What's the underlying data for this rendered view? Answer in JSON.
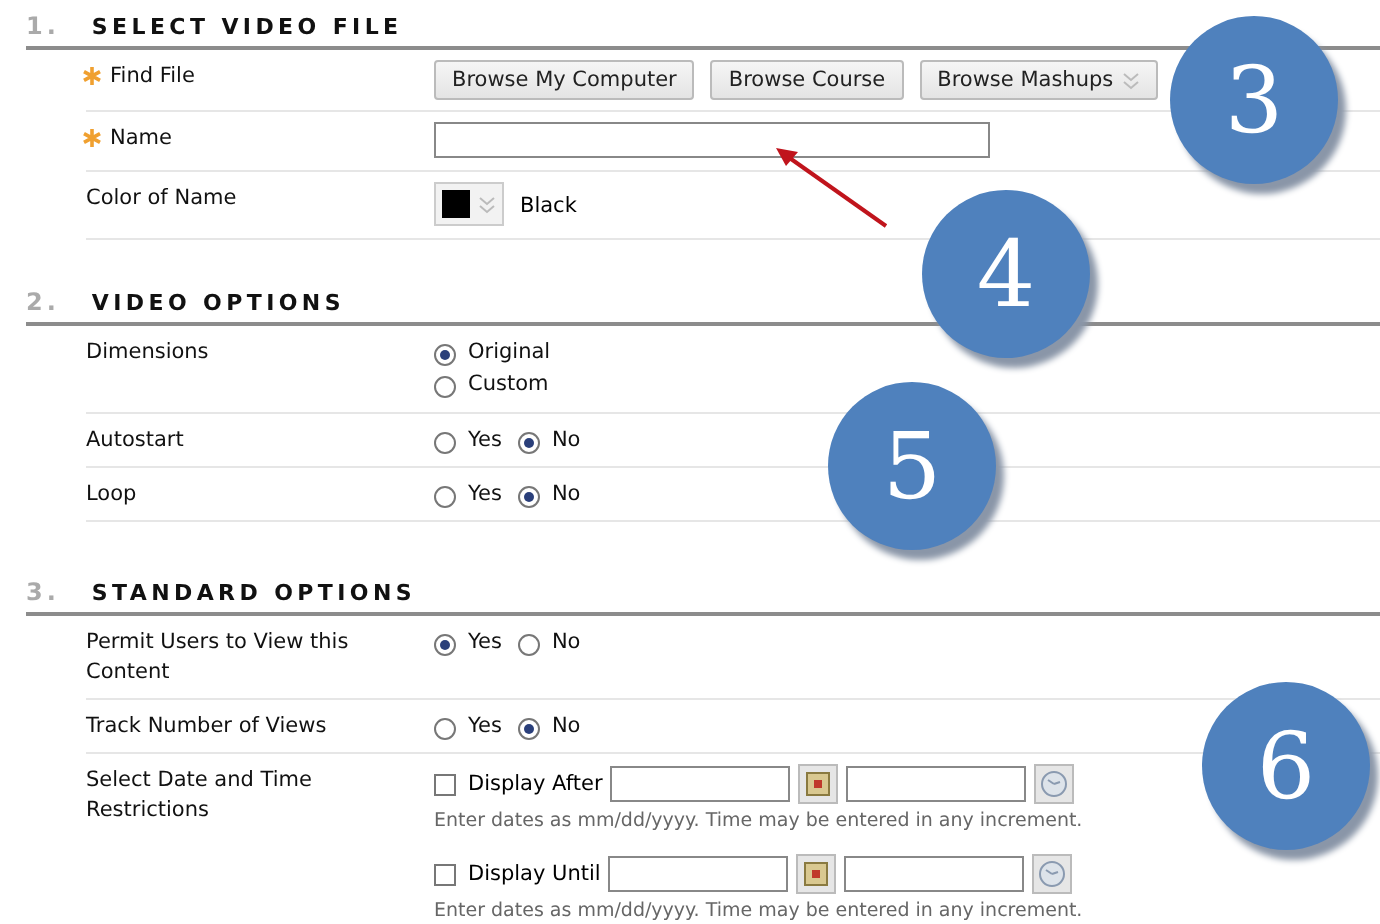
{
  "sections": [
    {
      "number": "1.",
      "title": "SELECT VIDEO FILE",
      "rows": [
        {
          "kind": "buttons",
          "label": "Find File",
          "required": true,
          "buttons": [
            {
              "label": "Browse My Computer",
              "dropdown": false
            },
            {
              "label": "Browse Course",
              "dropdown": false
            },
            {
              "label": "Browse Mashups",
              "dropdown": true
            }
          ]
        },
        {
          "kind": "text",
          "label": "Name",
          "required": true
        },
        {
          "kind": "color",
          "label": "Color of Name",
          "required": false,
          "color": "#000000",
          "value": "Black"
        }
      ]
    },
    {
      "number": "2.",
      "title": "VIDEO OPTIONS",
      "rows": [
        {
          "kind": "radio_stack",
          "label": "Dimensions",
          "required": false,
          "options": [
            {
              "label": "Original",
              "selected": true
            },
            {
              "label": "Custom",
              "selected": false
            }
          ]
        },
        {
          "kind": "radio_row",
          "label": "Autostart",
          "required": false,
          "options": [
            {
              "label": "Yes",
              "selected": false
            },
            {
              "label": "No",
              "selected": true
            }
          ]
        },
        {
          "kind": "radio_row",
          "label": "Loop",
          "required": false,
          "options": [
            {
              "label": "Yes",
              "selected": false
            },
            {
              "label": "No",
              "selected": true
            }
          ]
        }
      ]
    },
    {
      "number": "3.",
      "title": "STANDARD OPTIONS",
      "rows": [
        {
          "kind": "radio_row",
          "label": "Permit Users to View this Content",
          "required": false,
          "options": [
            {
              "label": "Yes",
              "selected": true
            },
            {
              "label": "No",
              "selected": false
            }
          ]
        },
        {
          "kind": "radio_row",
          "label": "Track Number of Views",
          "required": false,
          "options": [
            {
              "label": "Yes",
              "selected": false
            },
            {
              "label": "No",
              "selected": true
            }
          ]
        },
        {
          "kind": "dates",
          "label": "Select Date and Time Restrictions",
          "required": false,
          "entries": [
            {
              "label": "Display After",
              "checked": false,
              "hint": "Enter dates as mm/dd/yyyy. Time may be entered in any increment."
            },
            {
              "label": "Display Until",
              "checked": false,
              "hint": "Enter dates as mm/dd/yyyy. Time may be entered in any increment."
            }
          ]
        }
      ]
    }
  ],
  "callouts": [
    {
      "label": "3"
    },
    {
      "label": "4"
    },
    {
      "label": "5"
    },
    {
      "label": "6"
    }
  ]
}
